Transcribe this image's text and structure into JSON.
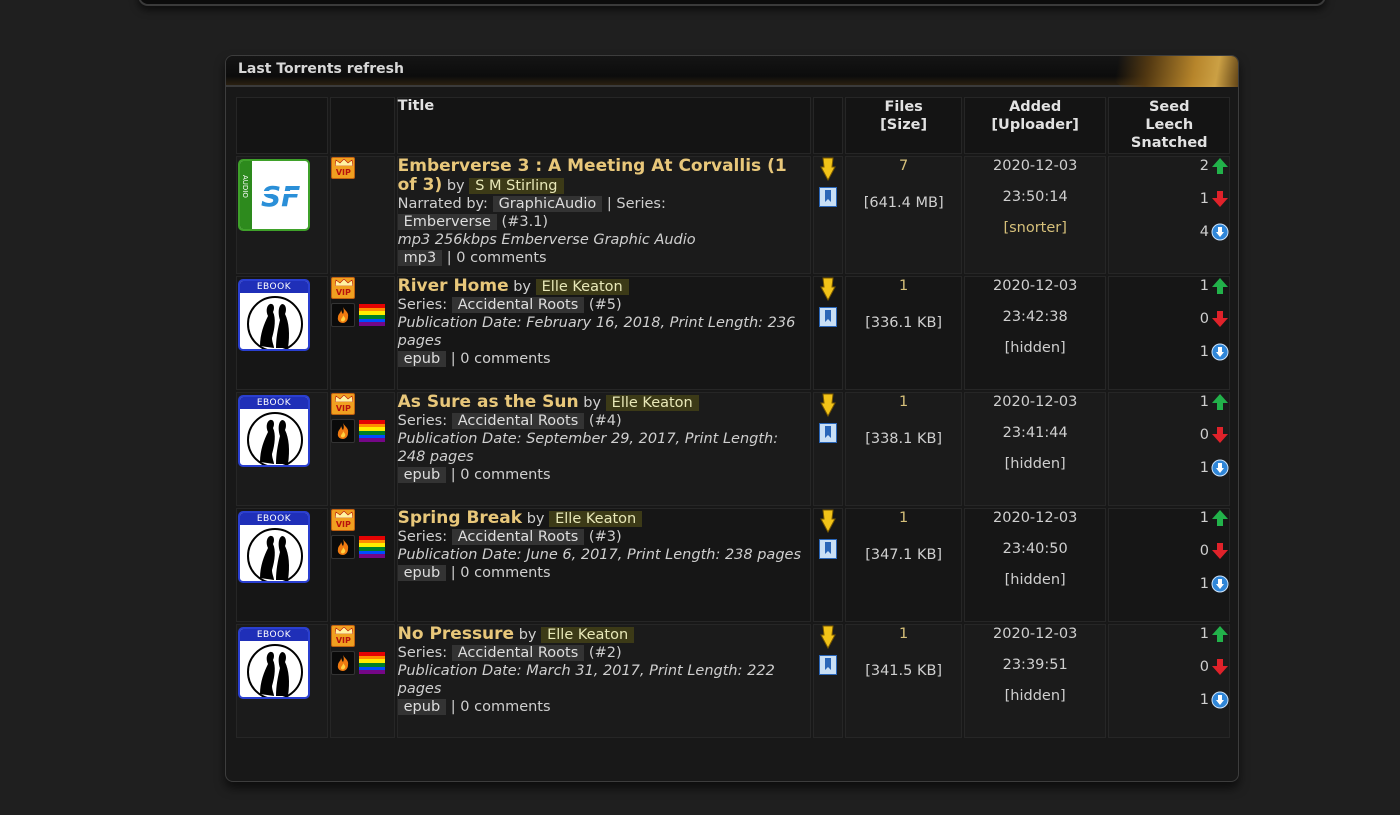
{
  "panel": {
    "title": "Last Torrents refresh"
  },
  "columns": {
    "title": "Title",
    "files_line1": "Files",
    "files_line2": "[Size]",
    "added_line1": "Added",
    "added_line2": "[Uploader]",
    "seed_line1": "Seed",
    "seed_line2": "Leech",
    "seed_line3": "Snatched"
  },
  "icon_names": {
    "audio_cover": "audiobook-cover-icon",
    "ebook_cover": "ebook-cover-icon",
    "vip": "vip-crown-icon",
    "fire": "hot-fire-icon",
    "rainbow": "rainbow-flag-icon",
    "download": "download-arrow-icon",
    "bookmark": "bookmark-icon",
    "seed": "green-up-arrow-icon",
    "leech": "red-down-arrow-icon",
    "snatched": "blue-snatched-icon"
  },
  "colors": {
    "title_gold": "#e8c77a",
    "author_tag_bg": "#3c3a17",
    "seed_green": "#22b24a",
    "leech_red": "#e0222a",
    "snatch_blue": "#2f86d8"
  },
  "torrents": [
    {
      "title": "Emberverse 3 : A Meeting At Corvallis (1 of 3)",
      "by": "by",
      "author": "S M Stirling",
      "narrated_label": "Narrated by:",
      "narrator": "GraphicAudio",
      "series_sep": "| Series:",
      "series": "Emberverse",
      "series_num": "(#3.1)",
      "description": "mp3 256kbps Emberverse Graphic Audio",
      "format": "mp3",
      "comments": "| 0 comments",
      "files": "7",
      "size": "[641.4 MB]",
      "date": "2020-12-03",
      "time": "23:50:14",
      "uploader": "[snorter]",
      "seed": "2",
      "leech": "1",
      "snatched": "4"
    },
    {
      "title": "River Home",
      "by": "by",
      "author": "Elle Keaton",
      "series_label": "Series:",
      "series": "Accidental Roots",
      "series_num": "(#5)",
      "description": "Publication Date: February 16, 2018, Print Length: 236 pages",
      "format": "epub",
      "comments": "| 0 comments",
      "files": "1",
      "size": "[336.1 KB]",
      "date": "2020-12-03",
      "time": "23:42:38",
      "uploader": "[hidden]",
      "seed": "1",
      "leech": "0",
      "snatched": "1"
    },
    {
      "title": "As Sure as the Sun",
      "by": "by",
      "author": "Elle Keaton",
      "series_label": "Series:",
      "series": "Accidental Roots",
      "series_num": "(#4)",
      "description": "Publication Date: September 29, 2017, Print Length: 248 pages",
      "format": "epub",
      "comments": "| 0 comments",
      "files": "1",
      "size": "[338.1 KB]",
      "date": "2020-12-03",
      "time": "23:41:44",
      "uploader": "[hidden]",
      "seed": "1",
      "leech": "0",
      "snatched": "1"
    },
    {
      "title": "Spring Break",
      "by": "by",
      "author": "Elle Keaton",
      "series_label": "Series:",
      "series": "Accidental Roots",
      "series_num": "(#3)",
      "description": "Publication Date: June 6, 2017, Print Length: 238 pages",
      "format": "epub",
      "comments": "| 0 comments",
      "files": "1",
      "size": "[347.1 KB]",
      "date": "2020-12-03",
      "time": "23:40:50",
      "uploader": "[hidden]",
      "seed": "1",
      "leech": "0",
      "snatched": "1"
    },
    {
      "title": "No Pressure",
      "by": "by",
      "author": "Elle Keaton",
      "series_label": "Series:",
      "series": "Accidental Roots",
      "series_num": "(#2)",
      "description": "Publication Date: March 31, 2017, Print Length: 222 pages",
      "format": "epub",
      "comments": "| 0 comments",
      "files": "1",
      "size": "[341.5 KB]",
      "date": "2020-12-03",
      "time": "23:39:51",
      "uploader": "[hidden]",
      "seed": "1",
      "leech": "0",
      "snatched": "1"
    }
  ]
}
